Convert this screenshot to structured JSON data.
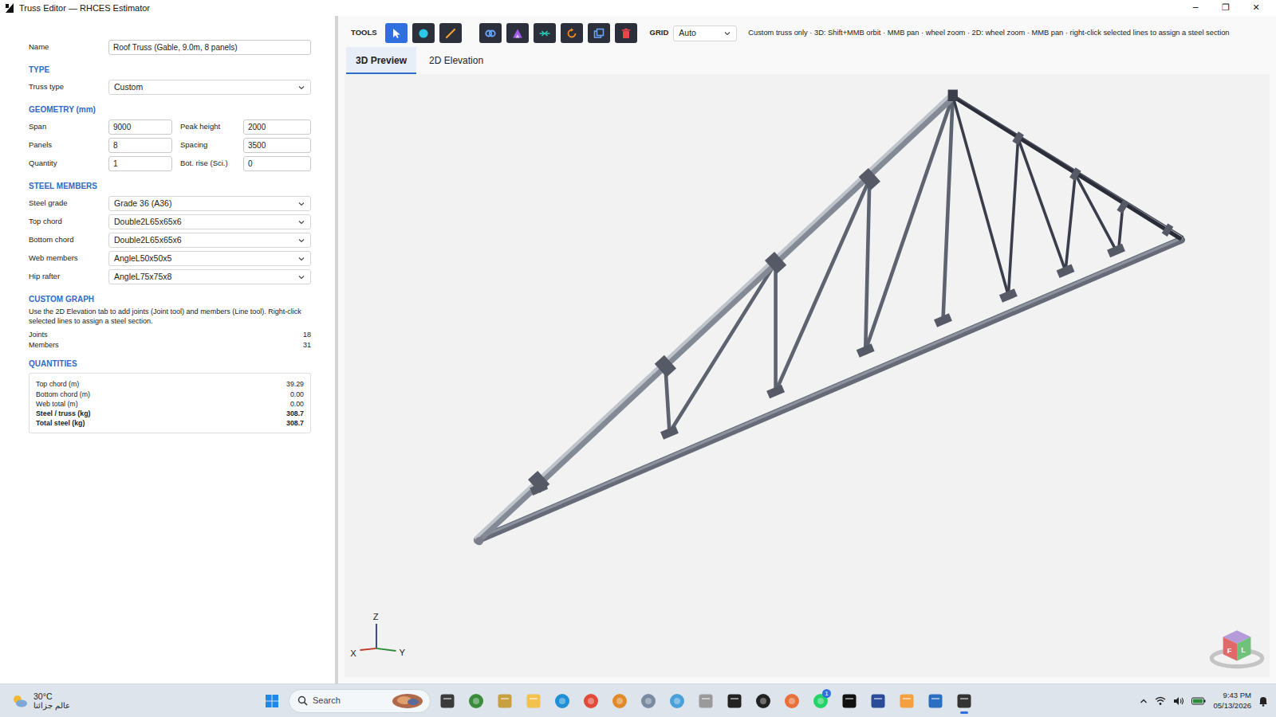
{
  "window": {
    "title": "Truss Editor — RHCES Estimator",
    "controls": [
      "─",
      "❐",
      "✕"
    ]
  },
  "left": {
    "name_label": "Name",
    "name_value": "Roof Truss (Gable, 9.0m, 8 panels)",
    "type_heading": "TYPE",
    "truss_type": {
      "label": "Truss type",
      "value": "Custom"
    },
    "geometry_heading": "GEOMETRY (mm)",
    "geometry": [
      {
        "label": "Span",
        "value": "9000"
      },
      {
        "label": "Peak height",
        "value": "2000"
      },
      {
        "label": "Panels",
        "value": "8"
      },
      {
        "label": "Spacing",
        "value": "3500"
      },
      {
        "label": "Quantity",
        "value": "1"
      },
      {
        "label": "Bot. rise (Sci.)",
        "value": "0"
      }
    ],
    "steel_heading": "STEEL MEMBERS",
    "steel": [
      {
        "label": "Steel grade",
        "value": "Grade 36 (A36)"
      },
      {
        "label": "Top chord",
        "value": "Double2L65x65x6"
      },
      {
        "label": "Bottom chord",
        "value": "Double2L65x65x6"
      },
      {
        "label": "Web members",
        "value": "AngleL50x50x5"
      },
      {
        "label": "Hip rafter",
        "value": "AngleL75x75x8"
      }
    ],
    "graph_heading": "CUSTOM GRAPH",
    "graph_note": "Use the 2D Elevation tab to add joints (Joint tool) and members (Line tool). Right-click selected lines to assign a steel section.",
    "graph_stats": [
      {
        "label": "Joints",
        "value": "18"
      },
      {
        "label": "Members",
        "value": "31"
      }
    ],
    "quantities_heading": "QUANTITIES",
    "quantities": [
      {
        "label": "Top chord (m)",
        "value": "39.29",
        "bold": false
      },
      {
        "label": "Bottom chord (m)",
        "value": "0.00",
        "bold": false
      },
      {
        "label": "Web total (m)",
        "value": "0.00",
        "bold": false
      },
      {
        "label": "Steel / truss (kg)",
        "value": "308.7",
        "bold": true
      },
      {
        "label": "Total steel (kg)",
        "value": "308.7",
        "bold": true
      }
    ]
  },
  "toolbar": {
    "label": "TOOLS",
    "tools": [
      {
        "kind": "select",
        "selected": true
      },
      {
        "kind": "joint",
        "selected": false
      },
      {
        "kind": "line",
        "selected": false
      },
      {
        "kind": "link",
        "selected": false
      },
      {
        "kind": "peak",
        "selected": false
      },
      {
        "kind": "split",
        "selected": false
      },
      {
        "kind": "rotate",
        "selected": false
      },
      {
        "kind": "copy",
        "selected": false
      },
      {
        "kind": "delete",
        "selected": false
      }
    ],
    "grid_label": "GRID",
    "grid_value": "Auto",
    "hint": "Custom truss only · 3D: Shift+MMB orbit · MMB pan · wheel zoom · 2D: wheel zoom · MMB pan · right-click selected lines to assign a steel section"
  },
  "tabs": [
    {
      "label": "3D Preview",
      "selected": true
    },
    {
      "label": "2D Elevation",
      "selected": false
    }
  ],
  "viewport": {
    "axes": {
      "z": "Z",
      "x": "X",
      "y": "Y"
    },
    "cube_faces": {
      "front": "F",
      "left": "L"
    }
  },
  "taskbar": {
    "weather_temp": "30°C",
    "weather_caption": "عالم جزائنا",
    "search": "Search",
    "whatsapp_badge": "1",
    "time": "9:43 PM",
    "date": "05/13/2026"
  }
}
